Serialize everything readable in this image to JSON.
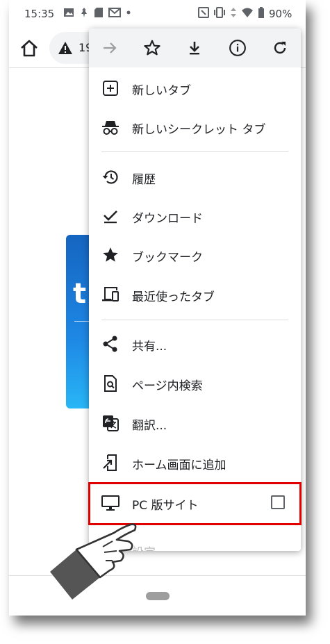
{
  "status_bar": {
    "time": "15:35",
    "battery": "90%",
    "left_icons": [
      "image-icon",
      "cast-icon",
      "sd-card-icon",
      "gmail-icon",
      "dot-icon"
    ],
    "right_icons": [
      "nfc-icon",
      "vibrate-icon",
      "data-arrows-icon",
      "wifi-icon",
      "battery-icon"
    ]
  },
  "toolbar": {
    "home_icon": "home-icon",
    "omnibox_warning_icon": "warning-icon",
    "omnibox_text": "19"
  },
  "page": {
    "banner_text": "t"
  },
  "menu": {
    "icon_bar": [
      "forward-icon",
      "star-outline-icon",
      "download-icon",
      "info-icon",
      "refresh-icon"
    ],
    "items": [
      {
        "label": "新しいタブ",
        "icon": "new-tab-icon"
      },
      {
        "label": "新しいシークレット タブ",
        "icon": "incognito-icon"
      },
      {
        "label": "履歴",
        "icon": "history-icon"
      },
      {
        "label": "ダウンロード",
        "icon": "downloads-icon"
      },
      {
        "label": "ブックマーク",
        "icon": "bookmark-star-icon"
      },
      {
        "label": "最近使ったタブ",
        "icon": "devices-icon"
      },
      {
        "label": "共有...",
        "icon": "share-icon"
      },
      {
        "label": "ページ内検索",
        "icon": "find-in-page-icon"
      },
      {
        "label": "翻訳...",
        "icon": "translate-icon"
      },
      {
        "label": "ホーム画面に追加",
        "icon": "add-to-home-icon"
      },
      {
        "label": "PC 版サイト",
        "icon": "desktop-icon",
        "checked": false
      },
      {
        "label": "設定"
      }
    ]
  },
  "colors": {
    "highlight": "#e00000",
    "icon_gray": "#5f6368",
    "banner_blue": "#1e88e5"
  }
}
